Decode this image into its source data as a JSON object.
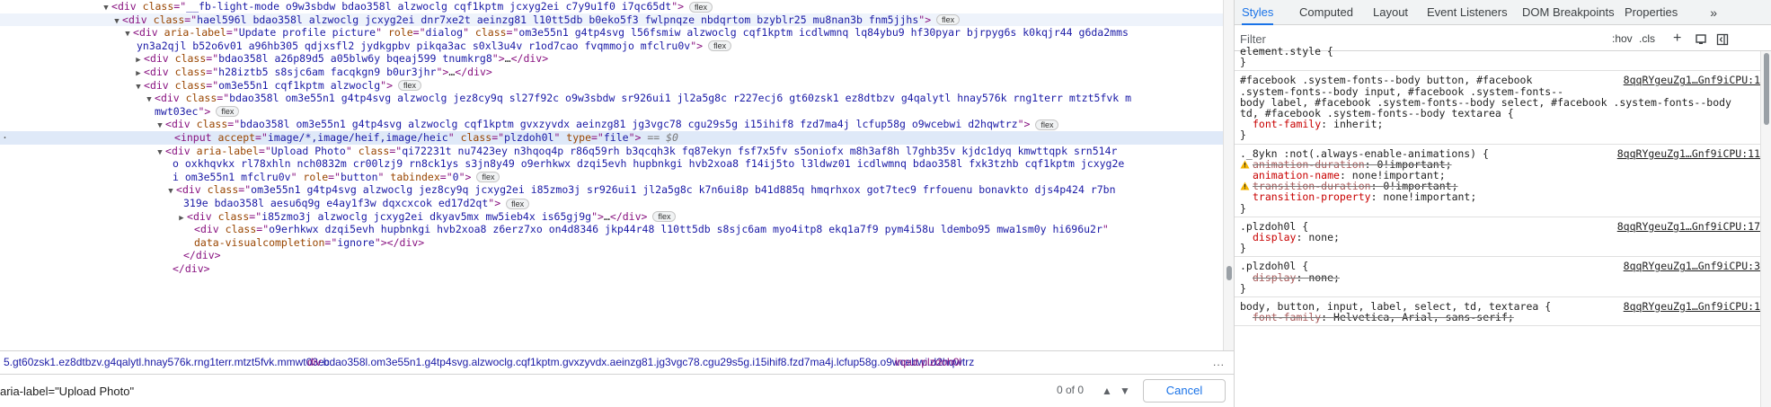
{
  "elements": {
    "lines": [
      {
        "indent": 124,
        "tri": "▼",
        "html": [
          [
            "p",
            "<"
          ],
          [
            "t",
            "div"
          ],
          [
            "s",
            " "
          ],
          [
            "a",
            "class"
          ],
          [
            "p",
            "=\""
          ],
          [
            "v",
            "__fb-light-mode o9w3sbdw bdao358l alzwoclg cqf1kptm jcxyg2ei c7y9u1f0 i7qc65dt"
          ],
          [
            "p",
            "\">"
          ]
        ],
        "badge": "flex"
      },
      {
        "indent": 136,
        "tri": "▼",
        "html": [
          [
            "p",
            "<"
          ],
          [
            "t",
            "div"
          ],
          [
            "s",
            " "
          ],
          [
            "a",
            "class"
          ],
          [
            "p",
            "=\""
          ],
          [
            "v",
            "hael596l bdao358l alzwoclg jcxyg2ei dnr7xe2t aeinzg81 l10tt5db b0eko5f3 fwlpnqze nbdqrtom bzyblr25 mu8nan3b fnm5jjhs"
          ],
          [
            "p",
            "\">"
          ]
        ],
        "badge": "flex",
        "hovered": true
      },
      {
        "indent": 148,
        "tri": "▼",
        "html": [
          [
            "p",
            "<"
          ],
          [
            "t",
            "div"
          ],
          [
            "s",
            " "
          ],
          [
            "a",
            "aria-label"
          ],
          [
            "p",
            "=\""
          ],
          [
            "v",
            "Update profile picture"
          ],
          [
            "p",
            "\" "
          ],
          [
            "a",
            "role"
          ],
          [
            "p",
            "=\""
          ],
          [
            "v",
            "dialog"
          ],
          [
            "p",
            "\" "
          ],
          [
            "a",
            "class"
          ],
          [
            "p",
            "=\""
          ],
          [
            "v",
            "om3e55n1 g4tp4svg l56fsmiw alzwoclg cqf1kptm icdlwmnq lq84ybu9 hf30pyar bjrpyg6s k0kqjr44 g6da2mms"
          ]
        ]
      },
      {
        "indent": 152,
        "tri": "",
        "html": [
          [
            "v",
            "yn3a2qjl b52o6v01 a96hb305 qdjxsfl2 jydkgpbv pikqa3ac s0xl3u4v r1od7cao fvqmmojo mfclru0v"
          ],
          [
            "p",
            "\">"
          ]
        ],
        "badge": "flex"
      },
      {
        "indent": 160,
        "tri": "▶",
        "html": [
          [
            "p",
            "<"
          ],
          [
            "t",
            "div"
          ],
          [
            "s",
            " "
          ],
          [
            "a",
            "class"
          ],
          [
            "p",
            "=\""
          ],
          [
            "v",
            "bdao358l a26p89d5 a05blw6y bqeaj599 tnumkrg8"
          ],
          [
            "p",
            "\">"
          ],
          [
            "x",
            "…"
          ],
          [
            "p",
            "</"
          ],
          [
            "t",
            "div"
          ],
          [
            "p",
            ">"
          ]
        ]
      },
      {
        "indent": 160,
        "tri": "▶",
        "html": [
          [
            "p",
            "<"
          ],
          [
            "t",
            "div"
          ],
          [
            "s",
            " "
          ],
          [
            "a",
            "class"
          ],
          [
            "p",
            "=\""
          ],
          [
            "v",
            "h28iztb5 s8sjc6am facqkgn9 b0ur3jhr"
          ],
          [
            "p",
            "\">"
          ],
          [
            "x",
            "…"
          ],
          [
            "p",
            "</"
          ],
          [
            "t",
            "div"
          ],
          [
            "p",
            ">"
          ]
        ]
      },
      {
        "indent": 160,
        "tri": "▼",
        "html": [
          [
            "p",
            "<"
          ],
          [
            "t",
            "div"
          ],
          [
            "s",
            " "
          ],
          [
            "a",
            "class"
          ],
          [
            "p",
            "=\""
          ],
          [
            "v",
            "om3e55n1 cqf1kptm alzwoclg"
          ],
          [
            "p",
            "\">"
          ]
        ],
        "badge": "flex"
      },
      {
        "indent": 172,
        "tri": "▼",
        "html": [
          [
            "p",
            "<"
          ],
          [
            "t",
            "div"
          ],
          [
            "s",
            " "
          ],
          [
            "a",
            "class"
          ],
          [
            "p",
            "=\""
          ],
          [
            "v",
            "bdao358l om3e55n1 g4tp4svg alzwoclg jez8cy9q sl27f92c o9w3sbdw sr926ui1 jl2a5g8c r227ecj6 gt60zsk1 ez8dtbzv g4qalytl hnay576k rng1terr mtzt5fvk m"
          ]
        ]
      },
      {
        "indent": 172,
        "tri": "",
        "html": [
          [
            "v",
            "mwt03ec"
          ],
          [
            "p",
            "\">"
          ]
        ],
        "badge": "flex"
      },
      {
        "indent": 184,
        "tri": "▼",
        "html": [
          [
            "p",
            "<"
          ],
          [
            "t",
            "div"
          ],
          [
            "s",
            " "
          ],
          [
            "a",
            "class"
          ],
          [
            "p",
            "=\""
          ],
          [
            "v",
            "bdao358l om3e55n1 g4tp4svg alzwoclg cqf1kptm gvxzyvdx aeinzg81 jg3vgc78 cgu29s5g i15ihif8 fzd7ma4j lcfup58g o9wcebwi d2hqwtrz"
          ],
          [
            "p",
            "\">"
          ]
        ],
        "badge": "flex"
      },
      {
        "indent": 194,
        "tri": "",
        "html": [
          [
            "p",
            "<"
          ],
          [
            "t",
            "input"
          ],
          [
            "s",
            " "
          ],
          [
            "a",
            "accept"
          ],
          [
            "p",
            "=\""
          ],
          [
            "v",
            "image/*,image/heif,image/heic"
          ],
          [
            "p",
            "\" "
          ],
          [
            "a",
            "class"
          ],
          [
            "p",
            "=\""
          ],
          [
            "v",
            "plzdoh0l"
          ],
          [
            "p",
            "\" "
          ],
          [
            "a",
            "type"
          ],
          [
            "p",
            "=\""
          ],
          [
            "v",
            "file"
          ],
          [
            "p",
            "\">"
          ],
          [
            "d",
            " == $0"
          ]
        ],
        "selected": true
      },
      {
        "indent": 184,
        "tri": "▼",
        "html": [
          [
            "p",
            "<"
          ],
          [
            "t",
            "div"
          ],
          [
            "s",
            " "
          ],
          [
            "a",
            "aria-label"
          ],
          [
            "p",
            "=\""
          ],
          [
            "v",
            "Upload Photo"
          ],
          [
            "p",
            "\" "
          ],
          [
            "a",
            "class"
          ],
          [
            "p",
            "=\""
          ],
          [
            "v",
            "qi72231t nu7423ey n3hqoq4p r86q59rh b3qcqh3k fq87ekyn fsf7x5fv s5oniofx m8h3af8h l7ghb35v kjdc1dyq kmwttqpk srn514r"
          ]
        ]
      },
      {
        "indent": 192,
        "tri": "",
        "html": [
          [
            "v",
            "o oxkhqvkx rl78xhln nch0832m cr00lzj9 rn8ck1ys s3jn8y49 o9erhkwx dzqi5evh hupbnkgi hvb2xoa8 f14ij5to l3ldwz01 icdlwmnq bdao358l fxk3tzhb cqf1kptm jcxyg2e"
          ]
        ]
      },
      {
        "indent": 192,
        "tri": "",
        "html": [
          [
            "v",
            "i om3e55n1 mfclru0v"
          ],
          [
            "p",
            "\" "
          ],
          [
            "a",
            "role"
          ],
          [
            "p",
            "=\""
          ],
          [
            "v",
            "button"
          ],
          [
            "p",
            "\" "
          ],
          [
            "a",
            "tabindex"
          ],
          [
            "p",
            "=\""
          ],
          [
            "v",
            "0"
          ],
          [
            "p",
            "\">"
          ]
        ],
        "badge": "flex"
      },
      {
        "indent": 196,
        "tri": "▼",
        "html": [
          [
            "p",
            "<"
          ],
          [
            "t",
            "div"
          ],
          [
            "s",
            " "
          ],
          [
            "a",
            "class"
          ],
          [
            "p",
            "=\""
          ],
          [
            "v",
            "om3e55n1 g4tp4svg alzwoclg jez8cy9q jcxyg2ei i85zmo3j sr926ui1 jl2a5g8c k7n6ui8p b41d885q hmqrhxox got7tec9 frfouenu bonavkto djs4p424 r7bn"
          ]
        ]
      },
      {
        "indent": 204,
        "tri": "",
        "html": [
          [
            "v",
            "319e bdao358l aesu6q9g e4ay1f3w dqxcxcok ed17d2qt"
          ],
          [
            "p",
            "\">"
          ]
        ],
        "badge": "flex"
      },
      {
        "indent": 208,
        "tri": "▶",
        "html": [
          [
            "p",
            "<"
          ],
          [
            "t",
            "div"
          ],
          [
            "s",
            " "
          ],
          [
            "a",
            "class"
          ],
          [
            "p",
            "=\""
          ],
          [
            "v",
            "i85zmo3j alzwoclg jcxyg2ei dkyav5mx mw5ieb4x is65gj9g"
          ],
          [
            "p",
            "\">"
          ],
          [
            "x",
            "…"
          ],
          [
            "p",
            "</"
          ],
          [
            "t",
            "div"
          ],
          [
            "p",
            ">"
          ]
        ],
        "badge": "flex"
      },
      {
        "indent": 216,
        "tri": "",
        "html": [
          [
            "p",
            "<"
          ],
          [
            "t",
            "div"
          ],
          [
            "s",
            " "
          ],
          [
            "a",
            "class"
          ],
          [
            "p",
            "=\""
          ],
          [
            "v",
            "o9erhkwx dzqi5evh hupbnkgi hvb2xoa8 z6erz7xo on4d8346 jkp44r48 l10tt5db s8sjc6am myo4itp8 ekq1a7f9 pym4i58u ldembo95 mwa1sm0y hi696u2r"
          ],
          [
            "p",
            "\""
          ]
        ]
      },
      {
        "indent": 216,
        "tri": "",
        "html": [
          [
            "a",
            "data-visualcompletion"
          ],
          [
            "p",
            "=\""
          ],
          [
            "v",
            "ignore"
          ],
          [
            "p",
            "\"></"
          ],
          [
            "t",
            "div"
          ],
          [
            "p",
            ">"
          ]
        ]
      },
      {
        "indent": 204,
        "tri": "",
        "html": [
          [
            "p",
            "</"
          ],
          [
            "t",
            "div"
          ],
          [
            "p",
            ">"
          ]
        ]
      },
      {
        "indent": 192,
        "tri": "",
        "html": [
          [
            "p",
            "</"
          ],
          [
            "t",
            "div"
          ],
          [
            "p",
            ">"
          ]
        ]
      }
    ]
  },
  "breadcrumb": {
    "items": [
      {
        "tag": "",
        "text": "5.gt60zsk1.ez8dtbzv.g4qalytl.hnay576k.rng1terr.mtzt5fvk.mmwt03ec"
      },
      {
        "tag": "div",
        "text": ".bdao358l.om3e55n1.g4tp4svg.alzwoclg.cqf1kptm.gvxzyvdx.aeinzg81.jg3vgc78.cgu29s5g.i15ihif8.fzd7ma4j.lcfup58g.o9wcebwi.d2hqwtrz"
      },
      {
        "tag": "input",
        "text": ".plzdoh0l"
      }
    ],
    "more": "..."
  },
  "search": {
    "value": "aria-label=\"Upload Photo\"",
    "count": "0 of 0",
    "cancel_label": "Cancel"
  },
  "styles": {
    "tabs": [
      "Styles",
      "Computed",
      "Layout",
      "Event Listeners",
      "DOM Breakpoints",
      "Properties"
    ],
    "tabs_more": "»",
    "filter_placeholder": "Filter",
    "hov": ":hov",
    "cls": ".cls",
    "plus": "+",
    "rules": [
      {
        "selector_lines": [
          "element.style {"
        ],
        "source": "",
        "props": [],
        "close": "}"
      },
      {
        "selector_lines": [
          "#facebook .system-fonts--body button, #facebook",
          ".system-fonts--body input, #facebook .system-fonts--",
          "body label, #facebook .system-fonts--body select, #facebook .system-fonts--body",
          "td, #facebook .system-fonts--body textarea {"
        ],
        "source": "8qqRYgeuZg1…Gnf9iCPU:1",
        "props": [
          {
            "name": "font-family",
            "value": "inherit;",
            "struck": false,
            "warn": false
          }
        ],
        "close": "}"
      },
      {
        "selector_lines": [
          "._8ykn :not(.always-enable-animations) {"
        ],
        "source": "8qqRYgeuZg1…Gnf9iCPU:11",
        "props": [
          {
            "name": "animation-duration",
            "value": "0!important;",
            "struck": true,
            "warn": true
          },
          {
            "name": "animation-name",
            "value": "none!important;",
            "struck": false,
            "warn": false
          },
          {
            "name": "transition-duration",
            "value": "0!important;",
            "struck": true,
            "warn": true
          },
          {
            "name": "transition-property",
            "value": "none!important;",
            "struck": false,
            "warn": false
          }
        ],
        "close": "}"
      },
      {
        "selector_lines": [
          ".plzdoh0l {"
        ],
        "source": "8qqRYgeuZg1…Gnf9iCPU:17",
        "props": [
          {
            "name": "display",
            "value": "none;",
            "struck": false,
            "warn": false
          }
        ],
        "close": "}"
      },
      {
        "selector_lines": [
          ".plzdoh0l {"
        ],
        "source": "8qqRYgeuZg1…Gnf9iCPU:3",
        "props": [
          {
            "name": "display",
            "value": "none;",
            "struck": true,
            "warn": false
          }
        ],
        "close": "}"
      },
      {
        "selector_lines": [
          "body, button, input, label, select, td, textarea {"
        ],
        "source": "8qqRYgeuZg1…Gnf9iCPU:1",
        "props": [
          {
            "name": "font-family",
            "value": "Helvetica, Arial, sans-serif;",
            "struck": true,
            "warn": false
          }
        ],
        "close": ""
      }
    ]
  },
  "colors": {
    "selected_row": "#dfe9f8",
    "tag": "#881280",
    "attr": "#994500",
    "value": "#1a1aa6",
    "accent": "#1a73e8",
    "property": "#c80000"
  }
}
